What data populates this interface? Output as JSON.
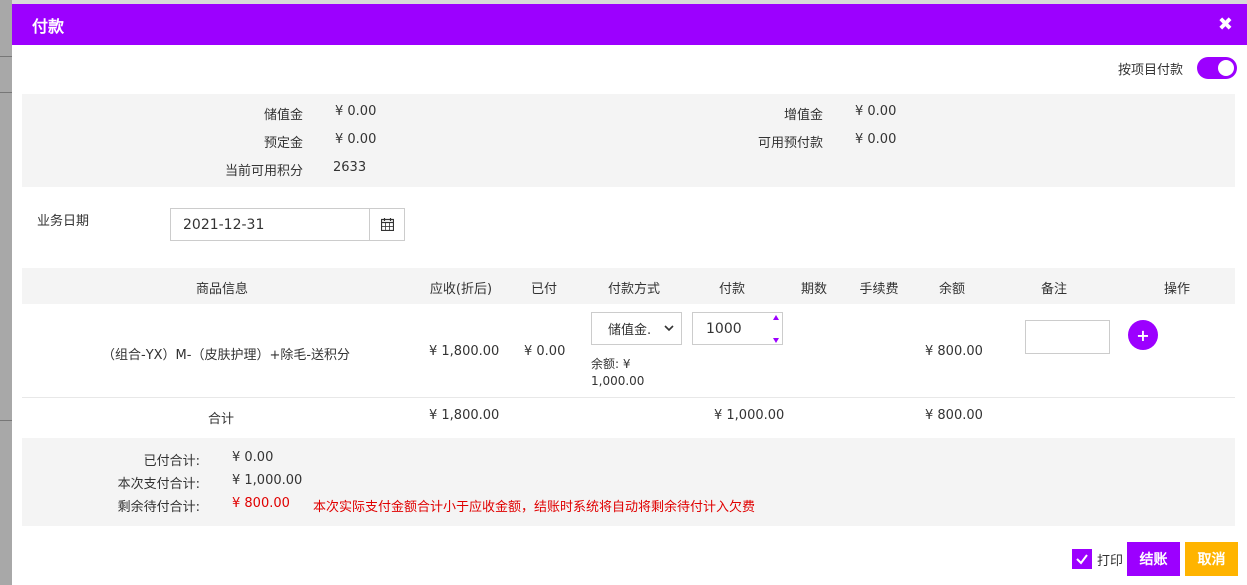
{
  "modal": {
    "title": "付款",
    "close_icon": "close-icon"
  },
  "toggle": {
    "label": "按项目付款",
    "checked": true
  },
  "balances": {
    "stored_value_label": "储值金",
    "stored_value": "¥ 0.00",
    "bonus_value_label": "增值金",
    "bonus_value": "¥ 0.00",
    "deposit_label": "预定金",
    "deposit": "¥ 0.00",
    "prepay_label": "可用预付款",
    "prepay": "¥ 0.00",
    "points_label": "当前可用积分",
    "points": "2633"
  },
  "business_date": {
    "label": "业务日期",
    "value": "2021-12-31",
    "calendar_icon": "calendar-icon"
  },
  "table": {
    "headers": [
      "商品信息",
      "应收(折后)",
      "已付",
      "付款方式",
      "付款",
      "期数",
      "手续费",
      "余额",
      "备注",
      "操作"
    ],
    "row": {
      "product": "（组合-YX）M-（皮肤护理）+除毛-送积分",
      "receivable": "¥ 1,800.00",
      "paid": "¥ 0.00",
      "method": "储值金.",
      "payment": "1000",
      "balance_note_line1": "余额: ¥",
      "balance_note_line2": "1,000.00",
      "balance": "¥ 800.00",
      "remark": ""
    },
    "total": {
      "label": "合计",
      "receivable": "¥ 1,800.00",
      "payment": "¥ 1,000.00",
      "balance": "¥ 800.00"
    }
  },
  "summary": {
    "paid_total_label": "已付合计:",
    "paid_total": "¥ 0.00",
    "this_payment_label": "本次支付合计:",
    "this_payment": "¥ 1,000.00",
    "remaining_label": "剩余待付合计:",
    "remaining": "¥ 800.00",
    "warning": "本次实际支付金额合计小于应收金额，结账时系统将自动将剩余待付计入欠费"
  },
  "footer": {
    "print_label": "打印",
    "print_checked": true,
    "checkout_label": "结账",
    "cancel_label": "取消"
  },
  "colors": {
    "accent": "#9c00ff",
    "cancel": "#ffb400",
    "warning": "#e00000"
  }
}
